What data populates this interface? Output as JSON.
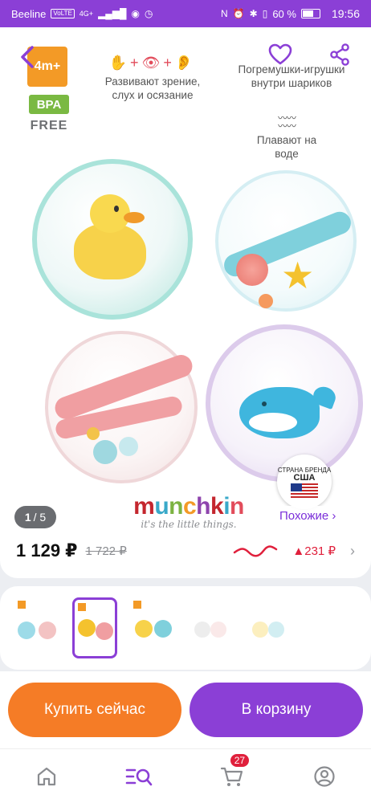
{
  "status_bar": {
    "carrier": "Beeline",
    "network": "VoLTE",
    "signal": "4G+",
    "battery": "60 %",
    "time": "19:56"
  },
  "product": {
    "age_badge": "4m+",
    "bpa_badge": "BPA",
    "free_badge": "FREE",
    "features": {
      "senses": "Развивают зрение, слух и осязание",
      "rattle": "Погремушки-игрушки внутри шариков",
      "float": "Плавают на воде"
    },
    "brand": {
      "name": [
        "m",
        "u",
        "n",
        "c",
        "h",
        "k",
        "i",
        "n"
      ],
      "tagline": "it's the little things."
    },
    "country": {
      "label": "СТРАНА БРЕНДА",
      "name": "США"
    },
    "similar_label": "Похожие ›",
    "gallery": {
      "current": "1",
      "total": "/ 5"
    },
    "price": "1 129 ₽",
    "old_price": "1 722 ₽",
    "price_change": "▲231 ₽"
  },
  "actions": {
    "buy_now": "Купить сейчас",
    "add_to_cart": "В корзину"
  },
  "tabbar": {
    "cart_count": "27"
  },
  "colors": {
    "brand_purple": "#8b3fd6",
    "buy_orange": "#f57c26",
    "price_up_red": "#e0203c"
  }
}
